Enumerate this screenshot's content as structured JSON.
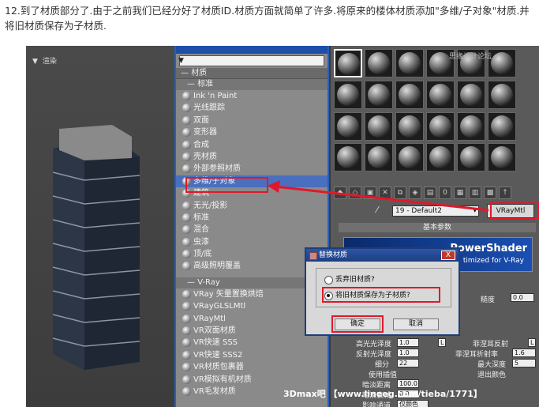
{
  "caption": "12.到了材质部分了.由于之前我们已经分好了材质ID.材质方面就简单了许多.将原来的楼体材质添加\"多维/子对象\"材质.并将旧材质保存为子材质.",
  "viewport": {
    "label": "渲染"
  },
  "browser": {
    "category": "材质",
    "standard_header": "标准",
    "standard_items": [
      "Ink 'n Paint",
      "光线跟踪",
      "双面",
      "变形器",
      "合成",
      "壳材质",
      "外部参照材质",
      "多维/子对象",
      "建筑",
      "无光/投影",
      "标准",
      "混合",
      "虫漆",
      "顶/底",
      "高级照明覆盖"
    ],
    "vray_header": "V-Ray",
    "vray_items": [
      "VRay 矢量置换烘焙",
      "VRayGLSLMtl",
      "VRayMtl",
      "VR双面材质",
      "VR快速 SSS",
      "VR快速 SSS2",
      "VR材质包裹器",
      "VR模拟有机材质",
      "VR毛发材质"
    ]
  },
  "editor": {
    "watermark": "思缘设计论坛",
    "material_name": "19 - Default2",
    "material_type": "VRayMtl",
    "rollout": "基本参数",
    "banner_title": "PowerShader",
    "banner_sub": "timized for V-Ray",
    "gloss_label": "糙度",
    "gloss_value": "0.0",
    "params": {
      "hilight": "高光光泽度",
      "hilight_val": "1.0",
      "hilight_key": "L",
      "fresnel": "菲涅耳反射",
      "fresnel_key": "L",
      "refl": "反射光泽度",
      "refl_val": "1.0",
      "ior": "菲涅耳折射率",
      "ior_val": "1.6",
      "subdiv": "细分",
      "subdiv_val": "22",
      "maxdepth": "最大深度",
      "maxdepth_val": "5",
      "interp": "使用插值",
      "exit": "退出颜色",
      "dim": "暗淡距离",
      "dim_val": "100.0",
      "dimfall": "暗淡衰减",
      "dimfall_val": "0.0",
      "affect": "影响通道",
      "affect_val": "仅颜色"
    }
  },
  "dialog": {
    "title": "替换材质",
    "close": "X",
    "option1": "丢弃旧材质?",
    "option2": "将旧材质保存为子材质?",
    "ok": "确定",
    "cancel": "取消"
  },
  "footer": "3Dmax吧 【www.lineeg.com/tieba/1771】",
  "colors": {
    "highlight": "#e0192a",
    "accent": "#2a5fb5"
  }
}
